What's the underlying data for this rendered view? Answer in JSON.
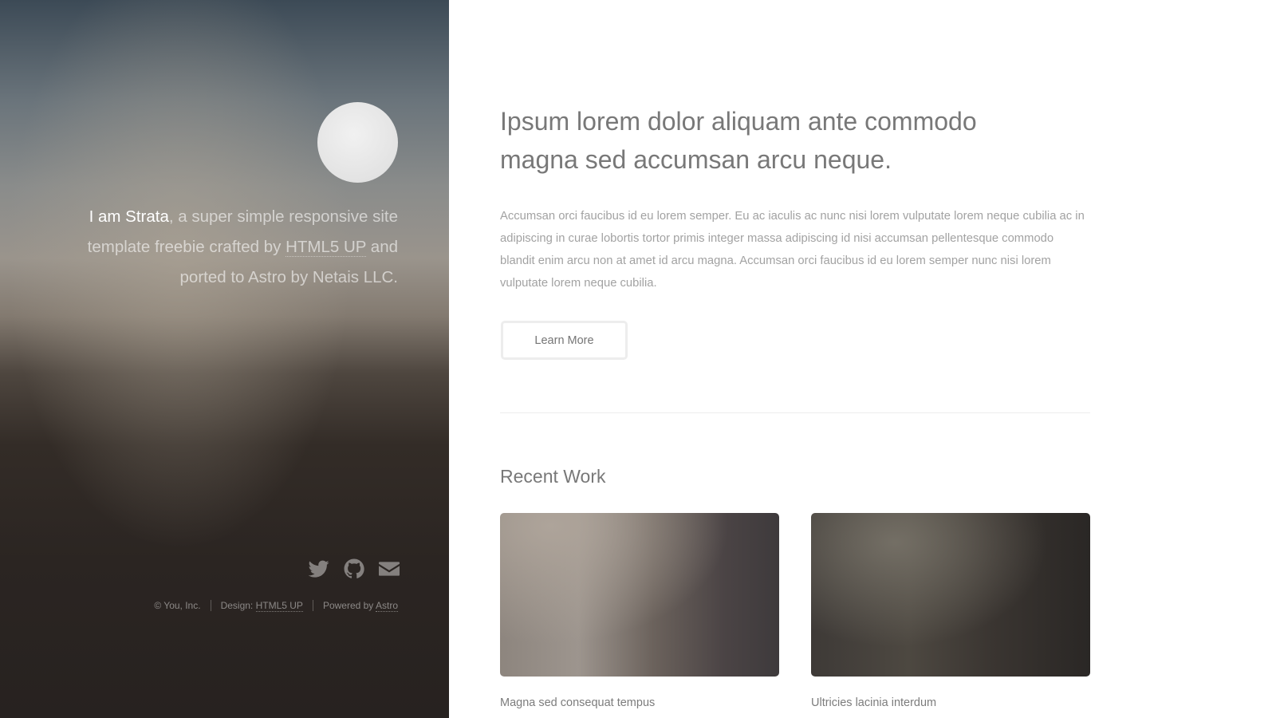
{
  "sidebar": {
    "intro": {
      "name": "I am Strata",
      "text_1": ", a super simple responsive site template freebie crafted by ",
      "link_1": "HTML5 UP",
      "text_2": " and ported to Astro by Netais LLC."
    },
    "social": [
      {
        "icon": "twitter-icon"
      },
      {
        "icon": "github-icon"
      },
      {
        "icon": "envelope-icon"
      }
    ],
    "footer": {
      "copyright": "© You, Inc.",
      "design_label": "Design: ",
      "design_link": "HTML5 UP",
      "powered_label": "Powered by ",
      "powered_link": "Astro"
    }
  },
  "main": {
    "headline": "Ipsum lorem dolor aliquam ante commodo magna sed accumsan arcu neque.",
    "lead": "Accumsan orci faucibus id eu lorem semper. Eu ac iaculis ac nunc nisi lorem vulputate lorem neque cubilia ac in adipiscing in curae lobortis tortor primis integer massa adipiscing id nisi accumsan pellentesque commodo blandit enim arcu non at amet id arcu magna. Accumsan orci faucibus id eu lorem semper nunc nisi lorem vulputate lorem neque cubilia.",
    "button_label": "Learn More",
    "recent_work": {
      "title": "Recent Work",
      "items": [
        {
          "caption": "Magna sed consequat tempus"
        },
        {
          "caption": "Ultricies lacinia interdum"
        }
      ]
    }
  }
}
